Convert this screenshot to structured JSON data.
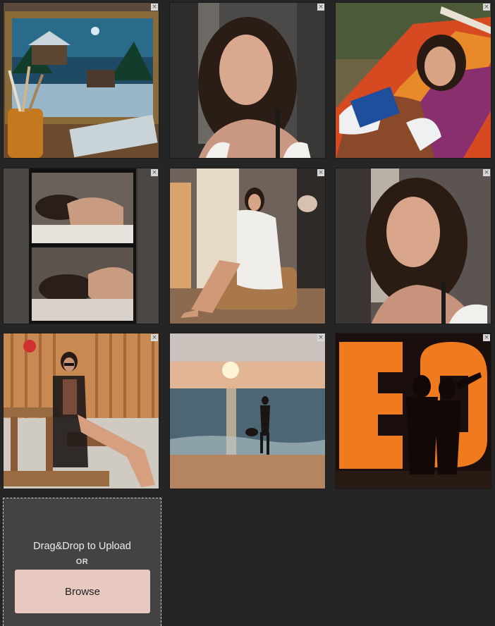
{
  "gallery": {
    "photos": [
      {
        "subject": "framed winter cabin painting with paintbrushes in jug",
        "remove_icon": "close-icon"
      },
      {
        "subject": "portrait of curly-haired woman",
        "remove_icon": "close-icon"
      },
      {
        "subject": "woman reading blue book in striped hammock",
        "remove_icon": "close-icon"
      },
      {
        "subject": "film-strip collage of woman lying in bed",
        "remove_icon": "close-icon"
      },
      {
        "subject": "woman in white robe seated on chair",
        "remove_icon": "close-icon"
      },
      {
        "subject": "close-up portrait of curly-haired woman",
        "remove_icon": "close-icon"
      },
      {
        "subject": "woman in sunglasses sitting on wooden bench",
        "remove_icon": "close-icon"
      },
      {
        "subject": "woman walking into the sea at sunset",
        "remove_icon": "close-icon"
      },
      {
        "subject": "silhouette of women before illuminated marquee letters",
        "remove_icon": "close-icon"
      }
    ],
    "close_glyph": "×"
  },
  "upload": {
    "drop_label": "Drag&Drop to Upload",
    "or_label": "OR",
    "browse_label": "Browse"
  },
  "colors": {
    "background": "#252525",
    "upload_panel": "#444242",
    "browse_button": "#e7c9bf"
  }
}
